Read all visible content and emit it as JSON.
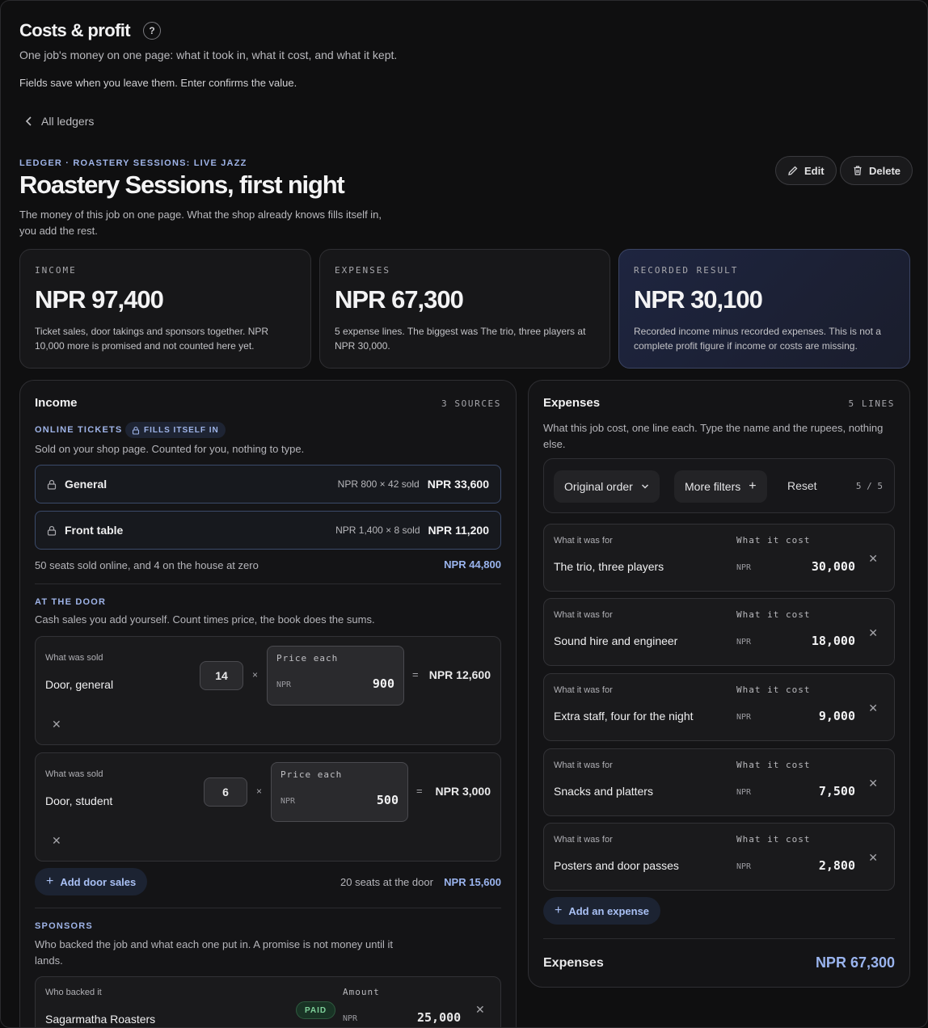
{
  "page": {
    "title": "Costs & profit",
    "help_icon": "?",
    "subtitle": "One job's money on one page: what it took in, what it cost, and what it kept.",
    "hint": "Fields save when you leave them. Enter confirms the value.",
    "back_label": "All ledgers"
  },
  "ledger": {
    "eyebrow": "LEDGER · ROASTERY SESSIONS: LIVE JAZZ",
    "title": "Roastery Sessions, first night",
    "desc_line1": "The money of this job on one page. What the shop already knows fills itself in,",
    "desc_line2": "you add the rest.",
    "edit_label": "Edit",
    "delete_label": "Delete"
  },
  "stats": [
    {
      "label": "INCOME",
      "value": "NPR 97,400",
      "desc1": "Ticket sales, door takings and sponsors together. NPR",
      "desc2": "10,000 more is promised and not counted here yet."
    },
    {
      "label": "EXPENSES",
      "value": "NPR 67,300",
      "desc1": "5 expense lines. The biggest was The trio, three players at",
      "desc2": "NPR 30,000."
    },
    {
      "label": "RECORDED RESULT",
      "value": "NPR 30,100",
      "desc1": "Recorded income minus recorded expenses. This is not a",
      "desc2": "complete profit figure if income or costs are missing."
    }
  ],
  "income": {
    "title": "Income",
    "count": "3 SOURCES",
    "online": {
      "label": "ONLINE TICKETS",
      "badge": "FILLS ITSELF IN",
      "desc": "Sold on your shop page. Counted for you, nothing to type.",
      "tiers": [
        {
          "name": "General",
          "math": "NPR 800 × 42 sold",
          "amount": "NPR 33,600"
        },
        {
          "name": "Front table",
          "math": "NPR 1,400 × 8 sold",
          "amount": "NPR 11,200"
        }
      ],
      "summary": "50 seats sold online, and 4 on the house at zero",
      "total": "NPR 44,800"
    },
    "door": {
      "label": "AT THE DOOR",
      "desc": "Cash sales you add yourself. Count times price, the book does the sums.",
      "what_label": "What was sold",
      "price_label": "Price each",
      "currency": "NPR",
      "times": "×",
      "equals": "=",
      "rows": [
        {
          "name": "Door, general",
          "qty": "14",
          "price": "900",
          "total": "NPR 12,600"
        },
        {
          "name": "Door, student",
          "qty": "6",
          "price": "500",
          "total": "NPR 3,000"
        }
      ],
      "add_label": "Add door sales",
      "summary": "20 seats at the door",
      "total": "NPR 15,600"
    },
    "sponsors": {
      "label": "SPONSORS",
      "desc1": "Who backed the job and what each one put in. A promise is not money until it",
      "desc2": "lands.",
      "who_label": "Who backed it",
      "amount_label": "Amount",
      "currency": "NPR",
      "rows": [
        {
          "name": "Sagarmatha Roasters",
          "status": "PAID",
          "amount": "25,000"
        }
      ]
    }
  },
  "expenses": {
    "title": "Expenses",
    "count": "5 LINES",
    "desc1": "What this job cost, one line each. Type the name and the rupees, nothing",
    "desc2": "else.",
    "sort_label": "Original order",
    "filters_label": "More filters",
    "reset_label": "Reset",
    "shown": "5 / 5",
    "for_label": "What it was for",
    "cost_label": "What it cost",
    "currency": "NPR",
    "lines": [
      {
        "name": "The trio, three players",
        "amount": "30,000"
      },
      {
        "name": "Sound hire and engineer",
        "amount": "18,000"
      },
      {
        "name": "Extra staff, four for the night",
        "amount": "9,000"
      },
      {
        "name": "Snacks and platters",
        "amount": "7,500"
      },
      {
        "name": "Posters and door passes",
        "amount": "2,800"
      }
    ],
    "add_label": "Add an expense",
    "total_label": "Expenses",
    "total": "NPR 67,300"
  },
  "colors": {
    "accent": "#9ab4ee",
    "paid": "#7fd19b",
    "result_card": "#1c2238"
  }
}
